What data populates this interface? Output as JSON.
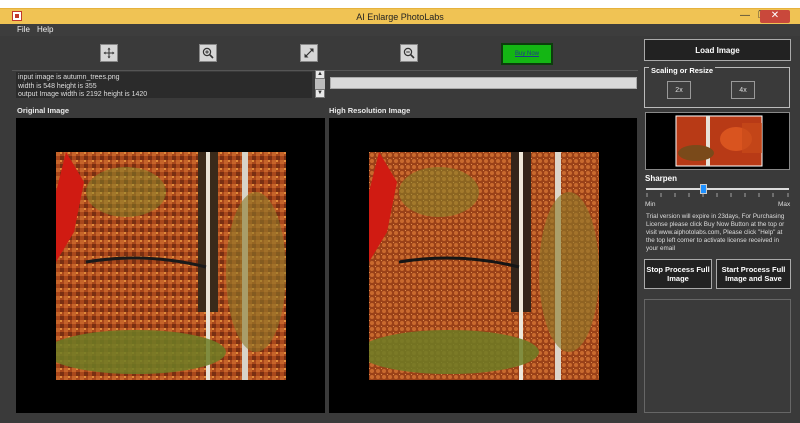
{
  "window": {
    "title": "AI Enlarge PhotoLabs"
  },
  "menu": {
    "items": [
      {
        "label": "File"
      },
      {
        "label": "Help"
      }
    ]
  },
  "toolbar": {
    "tools": [
      {
        "name": "move-tool",
        "icon": "move-icon"
      },
      {
        "name": "zoom-in-tool",
        "icon": "zoom-in-icon"
      },
      {
        "name": "fit-tool",
        "icon": "expand-icon"
      },
      {
        "name": "zoom-out-tool",
        "icon": "zoom-out-icon"
      }
    ],
    "buy_now": "Buy Now"
  },
  "info": {
    "lines": [
      "input image is autumn_trees.png",
      "width is 548 height is 355",
      "output Image width is 2192 height is 1420"
    ]
  },
  "progress": {
    "value": 0
  },
  "panels": {
    "original_label": "Original Image",
    "high_res_label": "High Resolution Image"
  },
  "sidebar": {
    "load_image": "Load Image",
    "scaling_title": "Scaling or Resize",
    "scale_2x": "2x",
    "scale_4x": "4x",
    "sharpen_label": "Sharpen",
    "sharpen_level": 0.4,
    "min_label": "Min",
    "max_label": "Max",
    "trial_text": "Trial version will expire in 23days, For Purchasing License please click Buy Now Button at the top or visit www.aiphotolabs.com, Please click \"Help\" at the top left corner to activate license received in your email",
    "stop_button": "Stop Process Full Image",
    "start_button": "Start Process Full Image and Save"
  },
  "colors": {
    "accent": "#1e90ff",
    "buy_now": "#14b614",
    "titlebar": "#f0c354"
  }
}
